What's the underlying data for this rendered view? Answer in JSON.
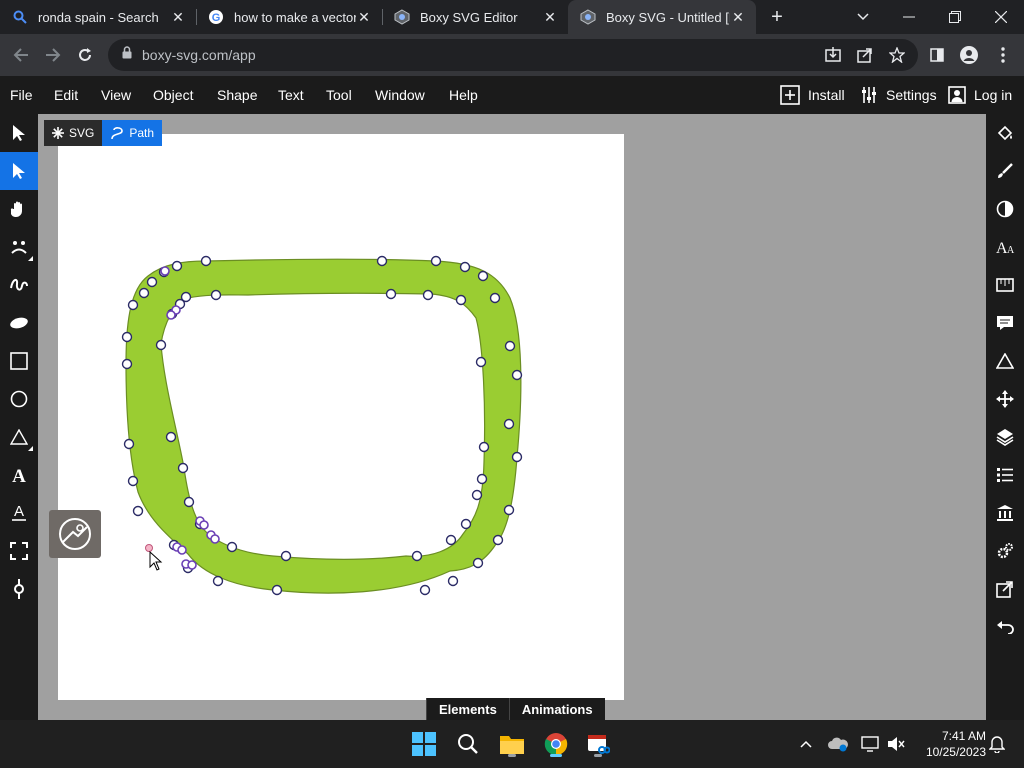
{
  "browser": {
    "tabs": [
      {
        "title": "ronda spain - Search",
        "icon": "search-icon"
      },
      {
        "title": "how to make a vector in boxy svg",
        "icon": "google-icon"
      },
      {
        "title": "Boxy SVG Editor",
        "icon": "boxy-icon"
      },
      {
        "title": "Boxy SVG - Untitled [Edited]",
        "icon": "boxy-icon",
        "active": true
      }
    ],
    "url": "boxy-svg.com/app"
  },
  "menubar": {
    "items": [
      "File",
      "Edit",
      "View",
      "Object",
      "Shape",
      "Text",
      "Tool",
      "Window",
      "Help"
    ],
    "install_label": "Install",
    "settings_label": "Settings",
    "login_label": "Log in"
  },
  "breadcrumb": {
    "svg_label": "SVG",
    "path_label": "Path"
  },
  "bottom_tabs": {
    "elements": "Elements",
    "animations": "Animations"
  },
  "shape": {
    "fill": "#9acd32",
    "stroke": "#6b8e23"
  },
  "colors": {
    "accent": "#1473e6",
    "chrome_dark": "#202124",
    "chrome_mid": "#35363a",
    "app_bar": "#1b1b1b",
    "canvas_bg": "#a0a0a0",
    "taskbar": "#202020"
  },
  "taskbar": {
    "time": "7:41 AM",
    "date": "10/25/2023"
  }
}
